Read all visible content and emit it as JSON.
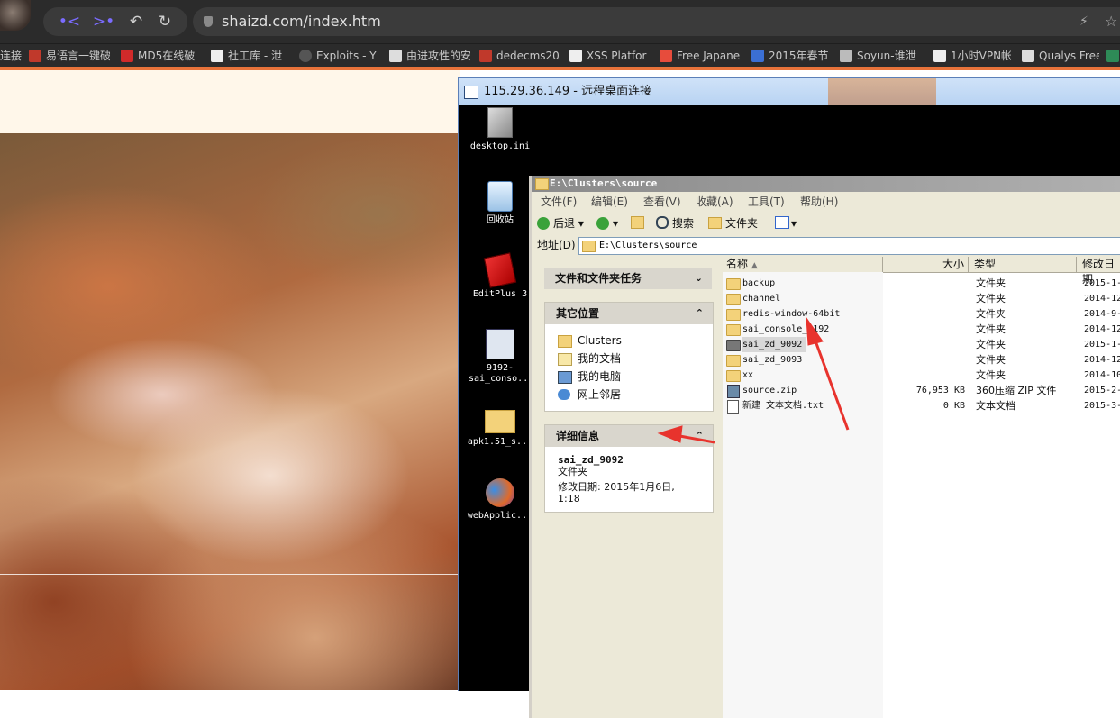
{
  "browser": {
    "url": "shaizd.com/index.htm",
    "bookmarks": [
      "连接",
      "易语言一键破",
      "MD5在线破",
      "社工库 - 泄",
      "Exploits - Y",
      "由进攻性的安",
      "dedecms20",
      "XSS Platfor",
      "Free Japane",
      "2015年春节",
      "Soyun-谁泄",
      "1小时VPN帐",
      "Qualys Free"
    ],
    "accent_color": "#e8733a"
  },
  "rdp": {
    "title": "115.29.36.149 - 远程桌面连接"
  },
  "desktop_icons": [
    {
      "label": "desktop.ini"
    },
    {
      "label": "回收站"
    },
    {
      "label": "EditPlus 3"
    },
    {
      "label": "9192-sai_conso..."
    },
    {
      "label": "apk1.51_s..."
    },
    {
      "label": "webApplic..."
    }
  ],
  "explorer": {
    "title": "E:\\Clusters\\source",
    "menu": [
      "文件(F)",
      "编辑(E)",
      "查看(V)",
      "收藏(A)",
      "工具(T)",
      "帮助(H)"
    ],
    "toolbar": {
      "back": "后退",
      "search": "搜索",
      "folders": "文件夹"
    },
    "address_label": "地址(D)",
    "address_value": "E:\\Clusters\\source",
    "task_pane": {
      "tasks_title": "文件和文件夹任务",
      "places_title": "其它位置",
      "places": [
        "Clusters",
        "我的文档",
        "我的电脑",
        "网上邻居"
      ],
      "details_title": "详细信息",
      "details_name": "sai_zd_9092",
      "details_type": "文件夹",
      "details_modified": "修改日期: 2015年1月6日, 1:18"
    },
    "columns": {
      "name": "名称",
      "size": "大小",
      "type": "类型",
      "modified": "修改日期"
    },
    "files": [
      {
        "name": "backup",
        "size": "",
        "type": "文件夹",
        "modified": "2015-1-"
      },
      {
        "name": "channel",
        "size": "",
        "type": "文件夹",
        "modified": "2014-12"
      },
      {
        "name": "redis-window-64bit",
        "size": "",
        "type": "文件夹",
        "modified": "2014-9-"
      },
      {
        "name": "sai_console_9192",
        "size": "",
        "type": "文件夹",
        "modified": "2014-12"
      },
      {
        "name": "sai_zd_9092",
        "size": "",
        "type": "文件夹",
        "modified": "2015-1-"
      },
      {
        "name": "sai_zd_9093",
        "size": "",
        "type": "文件夹",
        "modified": "2014-12"
      },
      {
        "name": "xx",
        "size": "",
        "type": "文件夹",
        "modified": "2014-10"
      },
      {
        "name": "source.zip",
        "size": "76,953 KB",
        "type": "360压缩 ZIP 文件",
        "modified": "2015-2-"
      },
      {
        "name": "新建 文本文档.txt",
        "size": "0 KB",
        "type": "文本文档",
        "modified": "2015-3-"
      }
    ]
  }
}
